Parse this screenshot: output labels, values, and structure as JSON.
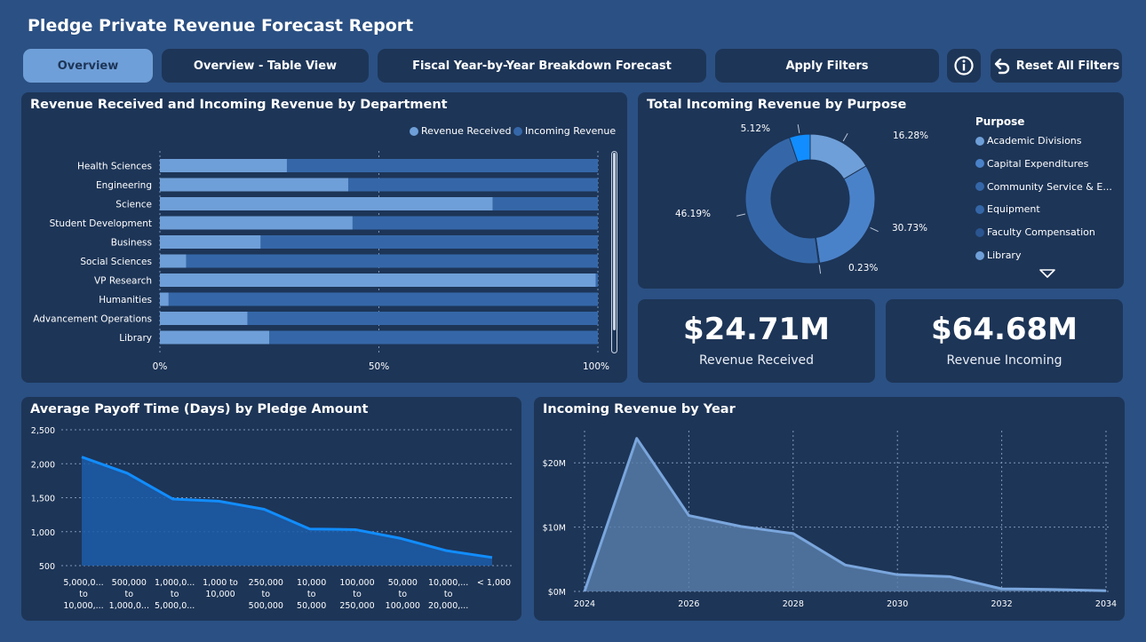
{
  "title": "Pledge Private Revenue Forecast Report",
  "nav": {
    "overview": "Overview",
    "table_view": "Overview - Table View",
    "fiscal": "Fiscal Year-by-Year Breakdown Forecast",
    "apply_filters": "Apply Filters",
    "info_icon": "info-icon",
    "reset": "Reset All Filters",
    "reset_icon": "undo-arrow-icon"
  },
  "colors": {
    "background": "#2b5083",
    "card": "#1d3557",
    "received": "#6f9fd8",
    "incoming": "#3567a8",
    "accent": "#118dff"
  },
  "chart_data": [
    {
      "type": "bar",
      "title": "Revenue Received and Incoming Revenue by Department",
      "stacked": "100%",
      "orientation": "horizontal",
      "legend_position": "top-right",
      "categories": [
        "Health Sciences",
        "Engineering",
        "Science",
        "Student Development",
        "Business",
        "Social Sciences",
        "VP Research",
        "Humanities",
        "Advancement Operations",
        "Library"
      ],
      "series": [
        {
          "name": "Revenue Received",
          "values": [
            29,
            43,
            76,
            44,
            23,
            6,
            99.5,
            2,
            20,
            25
          ]
        },
        {
          "name": "Incoming Revenue",
          "values": [
            71,
            57,
            24,
            56,
            77,
            94,
            0.5,
            98,
            80,
            75
          ]
        }
      ],
      "xticks": [
        "0%",
        "50%",
        "100%"
      ],
      "xlim": [
        0,
        100
      ],
      "grid": true
    },
    {
      "type": "pie",
      "title": "Total Incoming Revenue by Purpose",
      "legend_title": "Purpose",
      "legend_position": "right",
      "legend_items": [
        "Academic Divisions",
        "Capital Expenditures",
        "Community Service & E...",
        "Equipment",
        "Faculty Compensation",
        "Library"
      ],
      "slices": [
        {
          "label": "16.28%",
          "value": 16.28
        },
        {
          "label": "30.73%",
          "value": 30.73
        },
        {
          "label": "0.23%",
          "value": 0.23
        },
        {
          "label": "46.19%",
          "value": 46.19
        },
        {
          "label": "5.12%",
          "value": 5.12
        }
      ],
      "slice_colors": [
        "#6f9fd8",
        "#4a82c9",
        "#6f9fd8",
        "#3567a8",
        "#118dff"
      ],
      "legend_colors": [
        "#6f9fd8",
        "#4a82c9",
        "#3567a8",
        "#3567a8",
        "#2a5590",
        "#6f9fd8"
      ]
    },
    {
      "type": "area",
      "title": "Average Payoff Time (Days) by Pledge Amount",
      "categories": [
        [
          "5,000,0...",
          "to",
          "10,000,..."
        ],
        [
          "500,000",
          "to",
          "1,000,0..."
        ],
        [
          "1,000,0...",
          "to",
          "5,000,0..."
        ],
        [
          "1,000 to",
          "10,000"
        ],
        [
          "250,000",
          "to",
          "500,000"
        ],
        [
          "10,000",
          "to",
          "50,000"
        ],
        [
          "100,000",
          "to",
          "250,000"
        ],
        [
          "50,000",
          "to",
          "100,000"
        ],
        [
          "10,000,...",
          "to",
          "20,000,..."
        ],
        [
          "< 1,000"
        ]
      ],
      "values": [
        2100,
        1860,
        1480,
        1450,
        1330,
        1040,
        1030,
        900,
        720,
        620
      ],
      "ylim": [
        500,
        2500
      ],
      "yticks": [
        "2,500",
        "2,000",
        "1,500",
        "1,000",
        "500"
      ],
      "grid": true
    },
    {
      "type": "area",
      "title": "Incoming Revenue by Year",
      "x": [
        2024,
        2025,
        2026,
        2027,
        2028,
        2029,
        2030,
        2031,
        2032,
        2033,
        2034
      ],
      "values": [
        0,
        23.8,
        11.8,
        10.1,
        9.0,
        4.1,
        2.6,
        2.3,
        0.4,
        0.3,
        0.1
      ],
      "unit": "M",
      "xticks": [
        "2024",
        "2026",
        "2028",
        "2030",
        "2032",
        "2034"
      ],
      "yticks": [
        "$20M",
        "$10M",
        "$0M"
      ],
      "ylim": [
        0,
        25
      ],
      "grid": true
    }
  ],
  "kpis": [
    {
      "value": "$24.71M",
      "label": "Revenue Received"
    },
    {
      "value": "$64.68M",
      "label": "Revenue Incoming"
    }
  ]
}
